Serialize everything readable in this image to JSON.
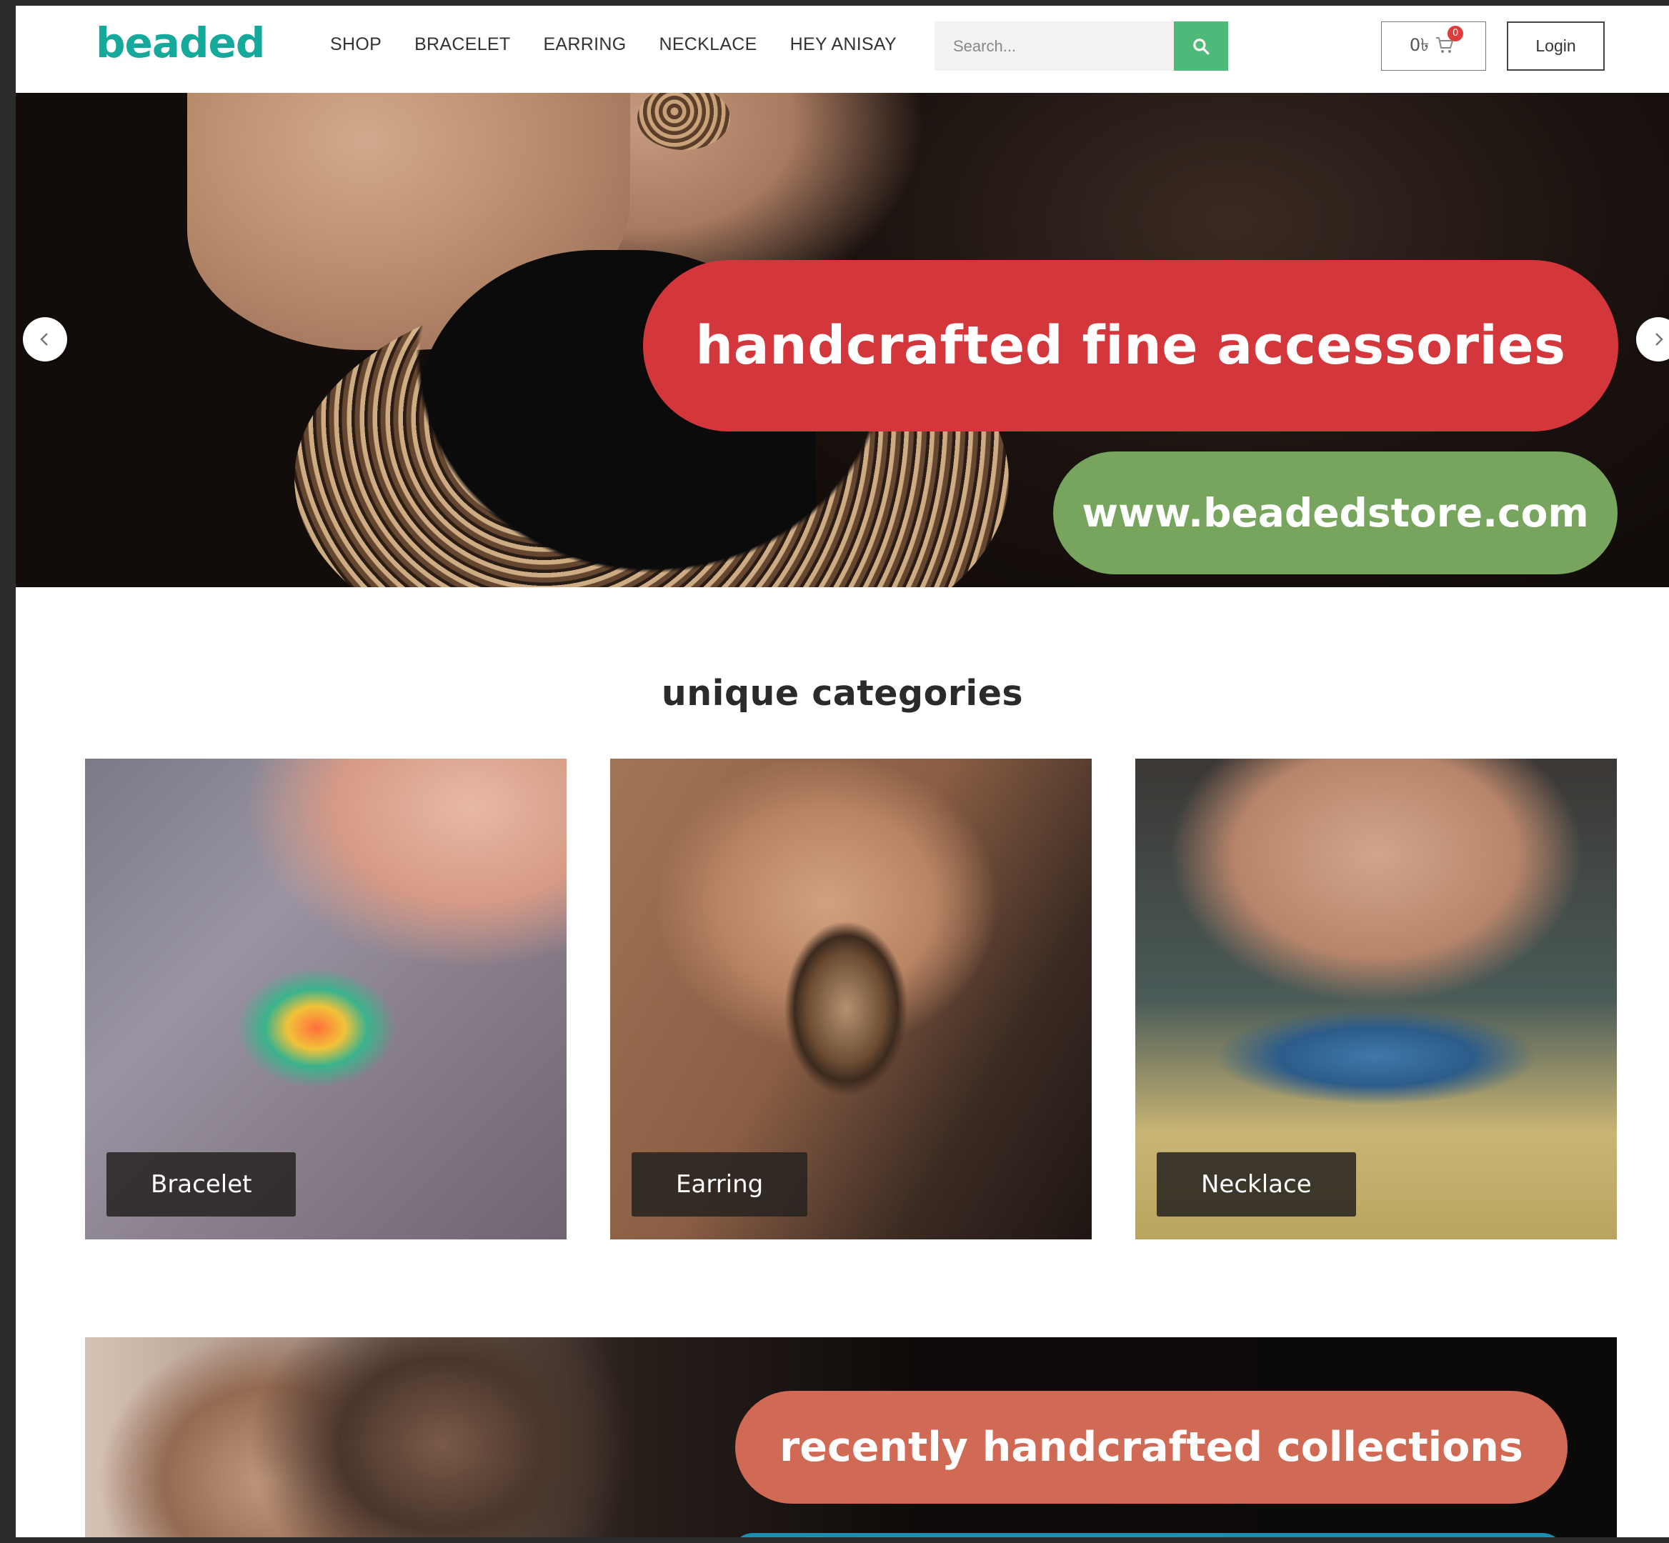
{
  "header": {
    "logo": "beaded",
    "nav": [
      "SHOP",
      "BRACELET",
      "EARRING",
      "NECKLACE",
      "HEY ANISAY"
    ],
    "search_placeholder": "Search...",
    "cart_amount": "0৳",
    "cart_count": "0",
    "login_label": "Login"
  },
  "hero": {
    "headline": "handcrafted fine accessories",
    "website": "www.beadedstore.com"
  },
  "categories": {
    "title": "unique categories",
    "items": [
      {
        "label": "Bracelet"
      },
      {
        "label": "Earring"
      },
      {
        "label": "Necklace"
      }
    ]
  },
  "banner": {
    "headline": "recently handcrafted collections"
  },
  "colors": {
    "logo": "#14a99a",
    "search_button": "#4dba7a",
    "hero_pill_red": "#d3373b",
    "hero_pill_green": "#77a55e",
    "banner_pill": "#d06a55",
    "banner_pill_teal": "#1b8fb1",
    "cart_badge": "#e03b3b"
  },
  "icons": [
    "search-icon",
    "cart-icon",
    "chevron-left-icon",
    "chevron-right-icon"
  ]
}
